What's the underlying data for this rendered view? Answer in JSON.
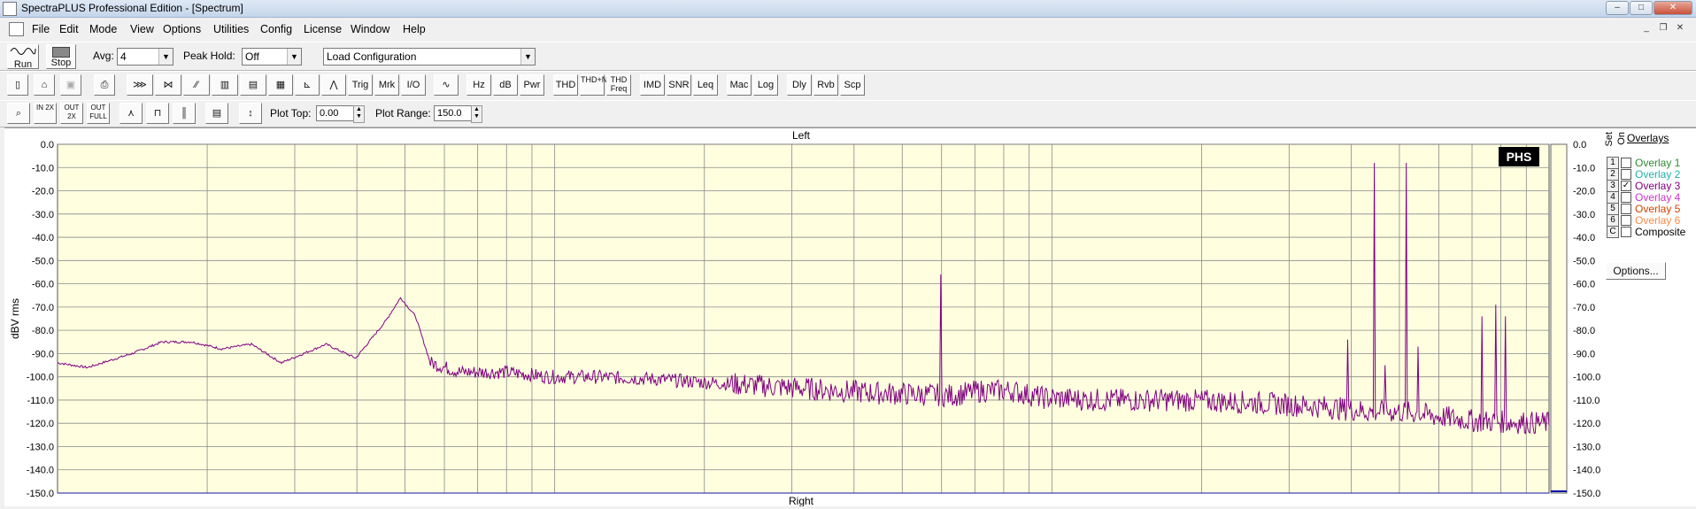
{
  "window": {
    "title": "SpectraPLUS Professional Edition - [Spectrum]"
  },
  "menu": [
    "File",
    "Edit",
    "Mode",
    "View",
    "Options",
    "Utilities",
    "Config",
    "License",
    "Window",
    "Help"
  ],
  "toolbar1": {
    "run_label": "Run",
    "stop_label": "Stop",
    "avg_label": "Avg:",
    "avg_value": "4",
    "peak_hold_label": "Peak Hold:",
    "peak_hold_value": "Off",
    "load_config_value": "Load Configuration"
  },
  "toolbar2": {
    "buttons": [
      "Trig",
      "Mrk",
      "I/O",
      "Hz",
      "dB",
      "Pwr",
      "THD",
      "THD+N",
      "THD Freq",
      "IMD",
      "SNR",
      "Leq",
      "Mac",
      "Log",
      "Dly",
      "Rvb",
      "Scp"
    ]
  },
  "toolbar3": {
    "zoom_labels": [
      "IN 2X",
      "OUT 2X",
      "OUT FULL"
    ],
    "plot_top_label": "Plot Top:",
    "plot_top_value": "0.00",
    "plot_range_label": "Plot Range:",
    "plot_range_value": "150.0"
  },
  "graph": {
    "top_label": "Left",
    "bottom_label": "Right",
    "logo": "PHS",
    "background": "#ffffe0",
    "trace_color": "#800080"
  },
  "chart_data": {
    "type": "line",
    "xlabel": "",
    "ylabel": "dBV rms",
    "ylim": [
      -150,
      0
    ],
    "y_ticks": [
      "0.0",
      "-10.0",
      "-20.0",
      "-30.0",
      "-40.0",
      "-50.0",
      "-60.0",
      "-70.0",
      "-80.0",
      "-90.0",
      "-100.0",
      "-110.0",
      "-120.0",
      "-130.0",
      "-140.0",
      "-150.0"
    ],
    "x_scale": "log",
    "series": [
      {
        "color": "#800080",
        "points": [
          [
            0.0,
            -94
          ],
          [
            0.02,
            -96
          ],
          [
            0.05,
            -90
          ],
          [
            0.07,
            -85
          ],
          [
            0.09,
            -85
          ],
          [
            0.11,
            -88
          ],
          [
            0.13,
            -86
          ],
          [
            0.15,
            -94
          ],
          [
            0.18,
            -86
          ],
          [
            0.2,
            -92
          ],
          [
            0.22,
            -76
          ],
          [
            0.23,
            -66
          ],
          [
            0.24,
            -74
          ],
          [
            0.25,
            -94
          ],
          [
            0.27,
            -98
          ],
          [
            0.3,
            -98
          ],
          [
            0.33,
            -100
          ],
          [
            0.36,
            -100
          ],
          [
            0.4,
            -101
          ],
          [
            0.45,
            -103
          ],
          [
            0.5,
            -105
          ],
          [
            0.55,
            -107
          ],
          [
            0.6,
            -108
          ],
          [
            0.62,
            -106
          ],
          [
            0.64,
            -106
          ],
          [
            0.66,
            -109
          ],
          [
            0.7,
            -110
          ],
          [
            0.75,
            -110
          ],
          [
            0.8,
            -111
          ],
          [
            0.85,
            -113
          ],
          [
            0.88,
            -115
          ],
          [
            0.9,
            -115
          ],
          [
            0.95,
            -119
          ],
          [
            1.0,
            -120
          ]
        ]
      }
    ],
    "peaks": [
      {
        "x": 0.592,
        "y": -56
      },
      {
        "x": 0.865,
        "y": -84
      },
      {
        "x": 0.883,
        "y": -8
      },
      {
        "x": 0.89,
        "y": -95
      },
      {
        "x": 0.904,
        "y": -8
      },
      {
        "x": 0.912,
        "y": -87
      },
      {
        "x": 0.955,
        "y": -74
      },
      {
        "x": 0.964,
        "y": -69
      },
      {
        "x": 0.971,
        "y": -74
      }
    ]
  },
  "overlays": {
    "title": "Overlays",
    "set_label": "Set",
    "on_label": "On",
    "items": [
      {
        "num": "1",
        "label": "Overlay 1",
        "color": "#2e8b2e",
        "checked": false
      },
      {
        "num": "2",
        "label": "Overlay 2",
        "color": "#20b2aa",
        "checked": false
      },
      {
        "num": "3",
        "label": "Overlay 3",
        "color": "#800080",
        "checked": true
      },
      {
        "num": "4",
        "label": "Overlay 4",
        "color": "#cc33cc",
        "checked": false
      },
      {
        "num": "5",
        "label": "Overlay 5",
        "color": "#cc4400",
        "checked": false
      },
      {
        "num": "6",
        "label": "Overlay 6",
        "color": "#ff8844",
        "checked": false
      },
      {
        "num": "C",
        "label": "Composite",
        "color": "#000000",
        "checked": false
      }
    ],
    "options_label": "Options..."
  }
}
